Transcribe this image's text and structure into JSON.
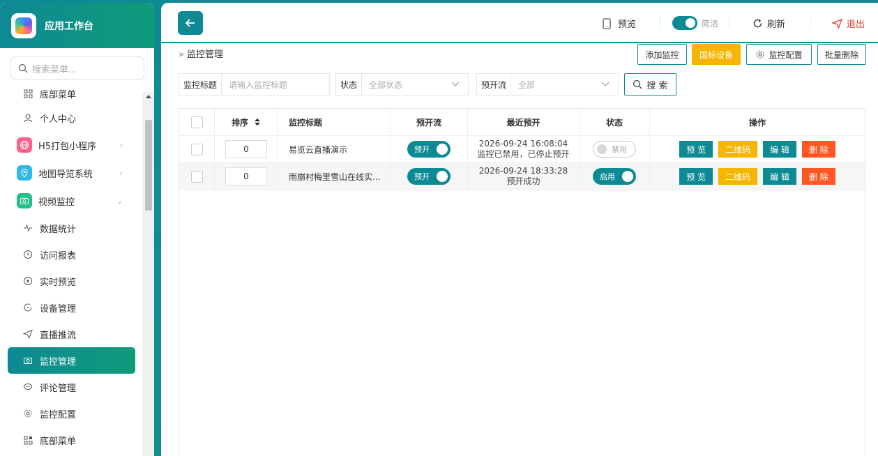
{
  "sidebar": {
    "title": "应用工作台",
    "search_placeholder": "搜索菜单...",
    "items": [
      {
        "label": "底部菜单",
        "icon": "grid-icon"
      },
      {
        "label": "个人中心",
        "icon": "user-icon"
      },
      {
        "label": "H5打包小程序",
        "icon": "globe-icon",
        "color": "#ff5f8a"
      },
      {
        "label": "地图导览系统",
        "icon": "map-pin-icon",
        "color": "#2fb8e8"
      },
      {
        "label": "视频监控",
        "icon": "camera-icon",
        "color": "#21c08b"
      },
      {
        "label": "数据统计",
        "icon": "pulse-icon"
      },
      {
        "label": "访问报表",
        "icon": "clock-icon"
      },
      {
        "label": "实时预览",
        "icon": "play-circle-icon"
      },
      {
        "label": "设备管理",
        "icon": "refresh-icon"
      },
      {
        "label": "直播推流",
        "icon": "send-icon"
      },
      {
        "label": "监控管理",
        "icon": "camera-icon"
      },
      {
        "label": "评论管理",
        "icon": "comment-icon"
      },
      {
        "label": "监控配置",
        "icon": "gear-icon"
      },
      {
        "label": "底部菜单",
        "icon": "grid-icon"
      }
    ]
  },
  "topbar": {
    "preview": "预览",
    "simple": "简洁",
    "refresh": "刷新",
    "logout": "退出"
  },
  "breadcrumb": {
    "mark": "»",
    "title": "监控管理"
  },
  "actions": {
    "add": "添加监控",
    "gb": "国标设备",
    "config": "监控配置",
    "batch_delete": "批量删除"
  },
  "filters": {
    "title_label": "监控标题",
    "title_placeholder": "请输入监控标题",
    "status_label": "状态",
    "status_value": "全部状态",
    "stream_label": "预开流",
    "stream_value": "全部",
    "search": "搜 索"
  },
  "table": {
    "headers": {
      "sort": "排序",
      "title": "监控标题",
      "stream": "预开流",
      "recent": "最近预开",
      "status": "状态",
      "ops": "操作"
    },
    "rows": [
      {
        "sort": "0",
        "title": "易览云直播演示",
        "stream": "预开",
        "time": "2026-09-24 16:08:04",
        "note": "监控已禁用，已停止预开",
        "status": "禁用"
      },
      {
        "sort": "0",
        "title": "雨崩村梅里雪山在线实...",
        "stream": "预开",
        "time": "2026-09-24 18:33:28",
        "note": "预开成功",
        "status": "启用"
      }
    ],
    "ops": {
      "preview": "预 览",
      "qrcode": "二维码",
      "edit": "编 辑",
      "delete": "删 除"
    }
  }
}
